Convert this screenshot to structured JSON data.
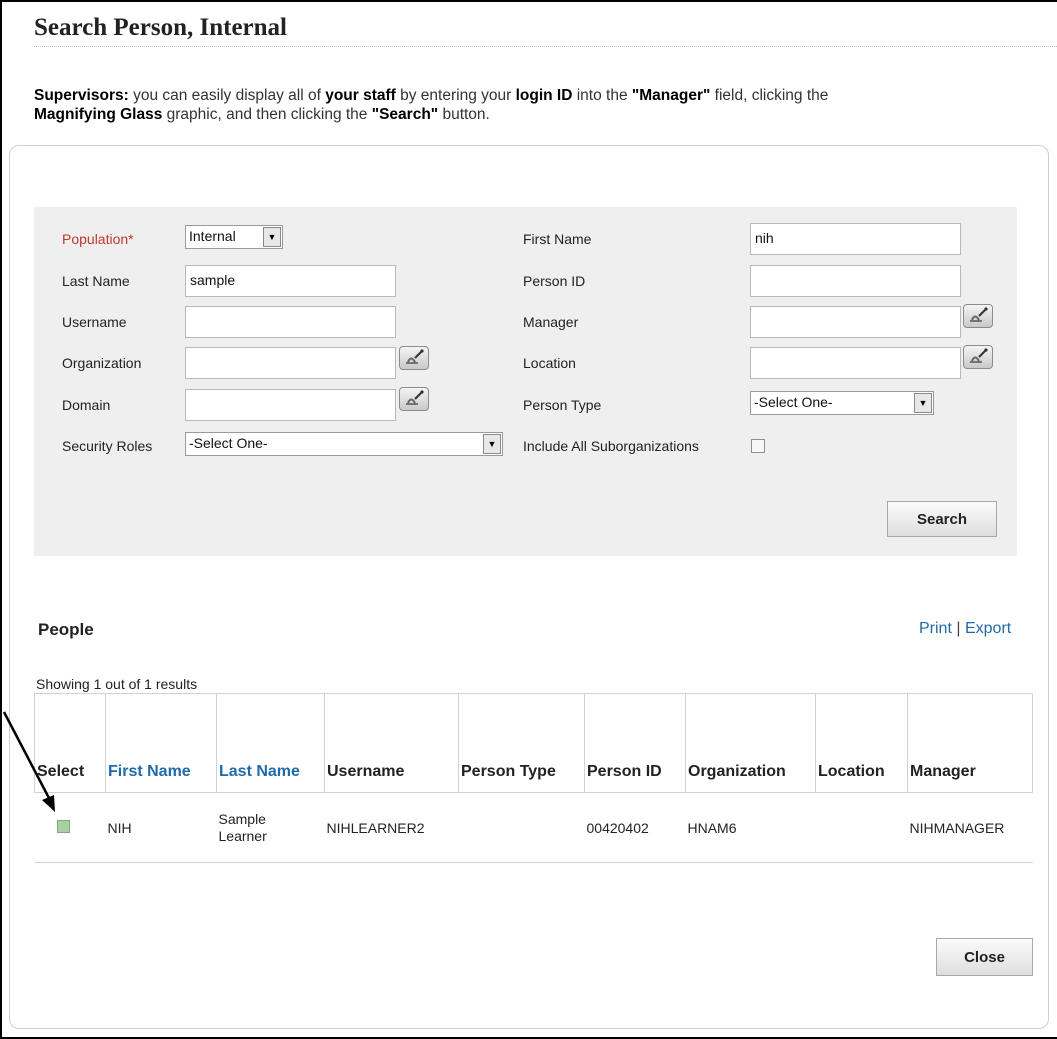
{
  "page": {
    "title": "Search Person, Internal",
    "intro": {
      "p1_bold": "Supervisors:",
      "p2": " you can easily display all of ",
      "p3_bold": "your staff",
      "p4": " by entering your ",
      "p5_bold": "login ID",
      "p6": " into the ",
      "p7_bold": "\"Manager\"",
      "p8": " field, clicking the",
      "p9_bold": "Magnifying Glass",
      "p10": " graphic, and then clicking the ",
      "p11_bold": "\"Search\"",
      "p12": " button."
    }
  },
  "form": {
    "population": {
      "label": "Population*",
      "value": "Internal"
    },
    "last_name": {
      "label": "Last Name",
      "value": "sample"
    },
    "username": {
      "label": "Username",
      "value": ""
    },
    "organization": {
      "label": "Organization",
      "value": ""
    },
    "domain": {
      "label": "Domain",
      "value": ""
    },
    "security_roles": {
      "label": "Security Roles",
      "value": "-Select One-"
    },
    "first_name": {
      "label": "First Name",
      "value": "nih"
    },
    "person_id": {
      "label": "Person ID",
      "value": ""
    },
    "manager": {
      "label": "Manager",
      "value": ""
    },
    "location": {
      "label": "Location",
      "value": ""
    },
    "person_type": {
      "label": "Person Type",
      "value": "-Select One-"
    },
    "include_suborgs": {
      "label": "Include All Suborganizations",
      "checked": false
    },
    "search_button": "Search"
  },
  "results": {
    "section_title": "People",
    "print_label": "Print",
    "separator": "|",
    "export_label": "Export",
    "showing": "Showing 1 out of 1 results",
    "columns": [
      "Select",
      "First Name",
      "Last Name",
      "Username",
      "Person Type",
      "Person ID",
      "Organization",
      "Location",
      "Manager"
    ],
    "rows": [
      {
        "first_name": "NIH",
        "last_name_line1": "Sample",
        "last_name_line2": "Learner",
        "username": "NIHLEARNER2",
        "person_type": "",
        "person_id": "00420402",
        "organization": "HNAM6",
        "location": "",
        "manager": "NIHMANAGER"
      }
    ]
  },
  "footer": {
    "close_button": "Close"
  },
  "colors": {
    "link": "#1f6aa8",
    "required_label": "#c0392b",
    "form_background": "#efefef",
    "select_marker": "#a9cfa3"
  },
  "icons": {
    "lookup": "magnifying-glass-icon",
    "dropdown": "dropdown-arrow-icon",
    "annotation": "annotation-arrow"
  }
}
